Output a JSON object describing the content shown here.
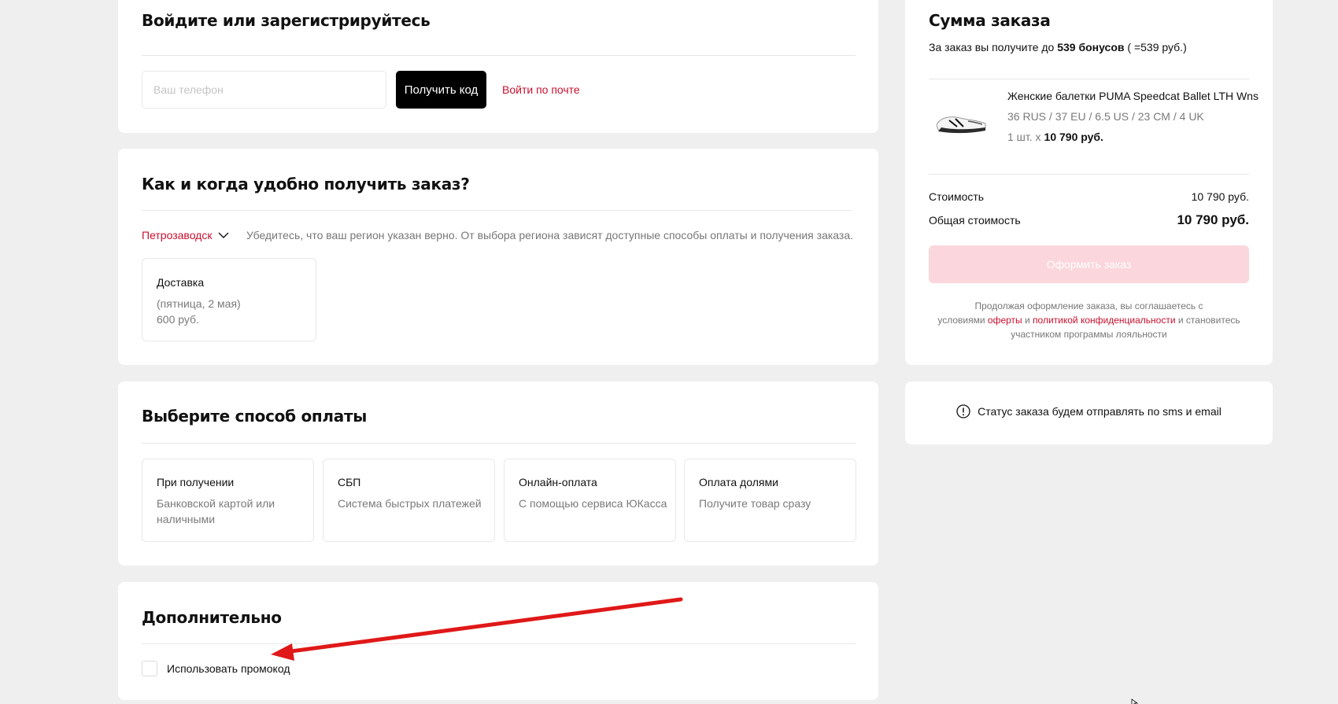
{
  "login": {
    "title": "Войдите или зарегистрируйтесь",
    "phone_placeholder": "Ваш телефон",
    "get_code_label": "Получить код",
    "email_login_label": "Войти по почте"
  },
  "delivery": {
    "title": "Как и когда удобно получить заказ?",
    "region": "Петрозаводск",
    "region_hint": "Убедитесь, что ваш регион указан верно. От выбора региона зависят доступные способы оплаты и получения заказа.",
    "option": {
      "title": "Доставка",
      "date": "(пятница, 2 мая)",
      "price": "600 руб."
    }
  },
  "payment": {
    "title": "Выберите способ оплаты",
    "options": [
      {
        "title": "При получении",
        "subtitle": "Банковской картой или наличными"
      },
      {
        "title": "СБП",
        "subtitle": "Система быстрых платежей"
      },
      {
        "title": "Онлайн-оплата",
        "subtitle": "С помощью сервиса ЮКасса"
      },
      {
        "title": "Оплата долями",
        "subtitle": "Получите товар сразу"
      }
    ]
  },
  "additional": {
    "title": "Дополнительно",
    "promo_label": "Использовать промокод"
  },
  "summary": {
    "title": "Сумма заказа",
    "bonus_prefix": "За заказ вы получите до",
    "bonus_amount": "539 бонусов",
    "bonus_suffix": "( =539 руб.)",
    "product": {
      "name": "Женские балетки PUMA Speedcat Ballet LTH Wns",
      "size": "36 RUS / 37 EU / 6.5 US / 23 CM / 4 UK",
      "qty": "1 шт.  х",
      "price": "10 790 руб."
    },
    "cost_label": "Стоимость",
    "cost_value": "10 790 руб.",
    "total_label": "Общая стоимость",
    "total_value": "10 790 руб.",
    "order_button": "Оформить заказ",
    "terms_1": "Продолжая оформление заказа, вы соглашаетесь с",
    "terms_2": "условиями",
    "terms_link_offer": "оферты",
    "terms_3": "и",
    "terms_link_privacy": "политикой конфиденциальности",
    "terms_4": "и становитесь",
    "terms_5": "участником программы лояльности"
  },
  "status": {
    "text": "Статус заказа будем отправлять по sms и email"
  },
  "colors": {
    "background": "#efefef",
    "accent": "#c8102e",
    "button_disabled": "#fbd6dc",
    "annotation_arrow": "#e01818"
  }
}
